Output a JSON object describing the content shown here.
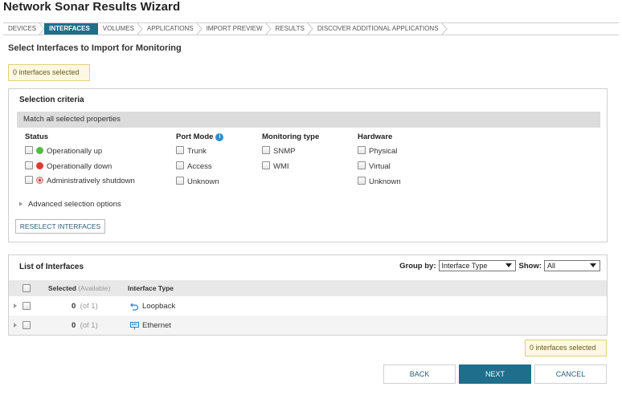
{
  "page": {
    "title": "Network Sonar Results Wizard",
    "subtitle": "Select Interfaces to Import for Monitoring"
  },
  "steps": [
    {
      "label": "DEVICES",
      "active": false
    },
    {
      "label": "INTERFACES",
      "active": true
    },
    {
      "label": "VOLUMES",
      "active": false
    },
    {
      "label": "APPLICATIONS",
      "active": false
    },
    {
      "label": "IMPORT PREVIEW",
      "active": false
    },
    {
      "label": "RESULTS",
      "active": false
    },
    {
      "label": "DISCOVER ADDITIONAL APPLICATIONS",
      "active": false
    }
  ],
  "selected_count_text": "0 interfaces selected",
  "criteria": {
    "title": "Selection criteria",
    "match_label": "Match all selected properties",
    "status": {
      "heading": "Status",
      "options": [
        "Operationally up",
        "Operationally down",
        "Administratively shutdown"
      ],
      "indicator_colors": [
        "#58b848",
        "#e03a2f",
        "#f2c4c4"
      ]
    },
    "port_mode": {
      "heading": "Port Mode",
      "info_icon": "info-icon",
      "info_glyph": "i",
      "options": [
        "Trunk",
        "Access",
        "Unknown"
      ]
    },
    "monitoring_type": {
      "heading": "Monitoring type",
      "options": [
        "SNMP",
        "WMI"
      ]
    },
    "hardware": {
      "heading": "Hardware",
      "options": [
        "Physical",
        "Virtual",
        "Unknown"
      ]
    },
    "advanced_label": "Advanced selection options",
    "reselect_label": "RESELECT INTERFACES"
  },
  "list": {
    "title": "List of Interfaces",
    "group_by_label": "Group by:",
    "group_by_value": "Interface Type",
    "show_label": "Show:",
    "show_value": "All",
    "columns": {
      "selected": "Selected",
      "available": "(Available)",
      "interface_type": "Interface Type"
    },
    "rows": [
      {
        "selected": "0",
        "available": "(of 1)",
        "type": "Loopback",
        "icon": "loopback-icon"
      },
      {
        "selected": "0",
        "available": "(of 1)",
        "type": "Ethernet",
        "icon": "ethernet-icon"
      }
    ]
  },
  "buttons": {
    "back": "BACK",
    "next": "NEXT",
    "cancel": "CANCEL"
  },
  "colors": {
    "accent": "#1f6e8c",
    "notice_bg": "#fdf8e2",
    "notice_border": "#e3cf7a"
  }
}
